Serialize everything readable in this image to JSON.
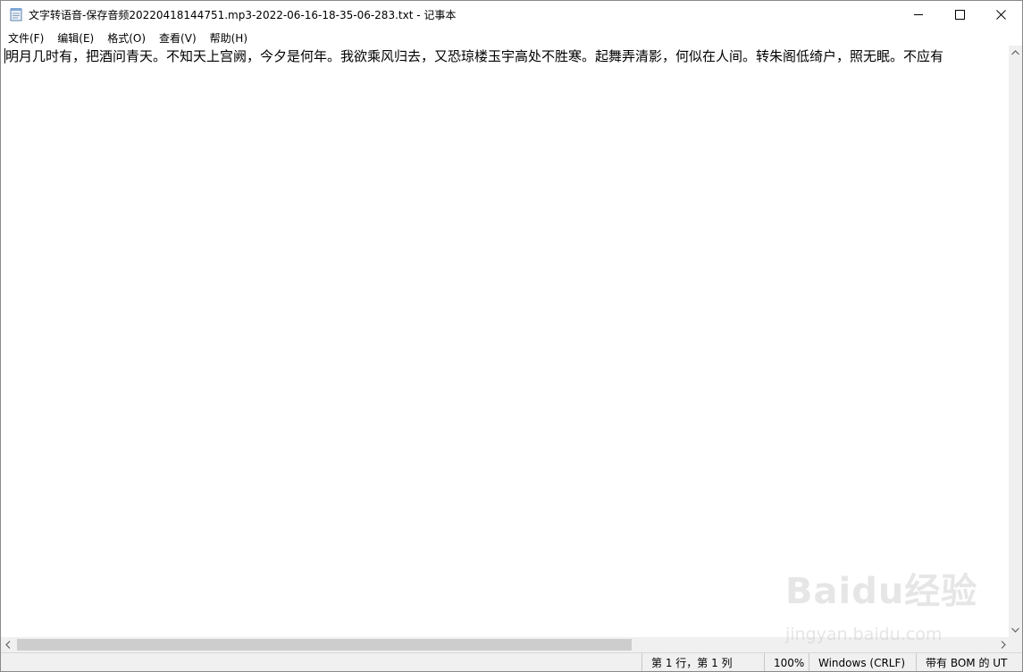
{
  "window": {
    "title": "文字转语音-保存音频20220418144751.mp3-2022-06-16-18-35-06-283.txt - 记事本"
  },
  "menu": [
    {
      "label": "文件(F)"
    },
    {
      "label": "编辑(E)"
    },
    {
      "label": "格式(O)"
    },
    {
      "label": "查看(V)"
    },
    {
      "label": "帮助(H)"
    }
  ],
  "editor": {
    "text": "明月几时有，把酒问青天。不知天上宫阙，今夕是何年。我欲乘风归去，又恐琼楼玉宇高处不胜寒。起舞弄清影，何似在人间。转朱阁低绮户，照无眠。不应有"
  },
  "status": {
    "position": "第 1 行，第 1 列",
    "zoom": "100%",
    "line_ending": "Windows (CRLF)",
    "encoding": "带有 BOM 的 UT"
  },
  "watermark": {
    "logo": "Baidu经验",
    "url": "jingyan.baidu.com"
  },
  "colors": {
    "scrollbar_track": "#f0f0f0",
    "scrollbar_thumb": "#cdcdcd",
    "statusbar_bg": "#f0f0f0"
  },
  "icons": {
    "app": "notepad-icon",
    "minimize": "minimize-icon",
    "maximize": "maximize-icon",
    "close": "close-icon"
  }
}
